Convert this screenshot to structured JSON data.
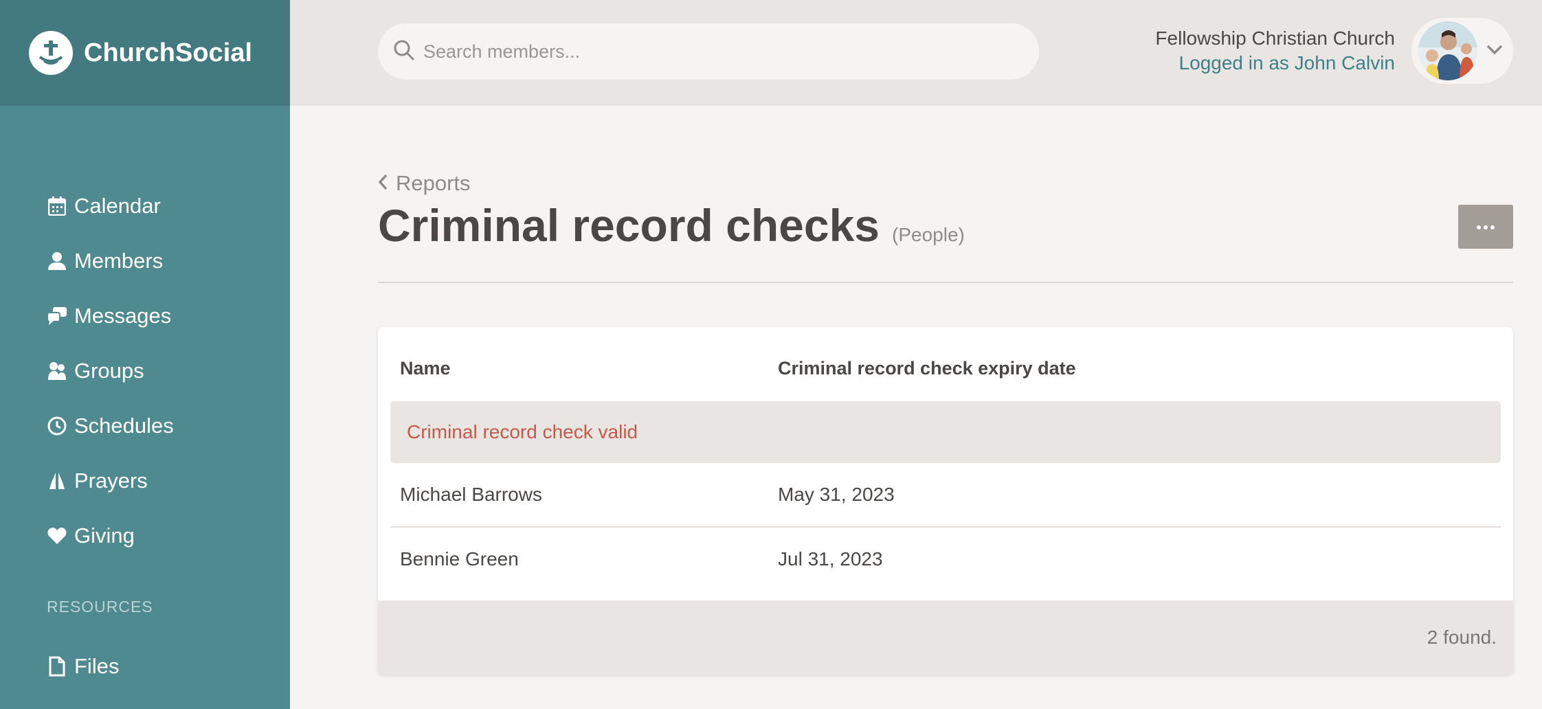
{
  "brand": {
    "name": "ChurchSocial"
  },
  "nav": {
    "items": [
      {
        "label": "Calendar",
        "icon": "calendar-icon"
      },
      {
        "label": "Members",
        "icon": "person-icon"
      },
      {
        "label": "Messages",
        "icon": "chat-bubbles-icon"
      },
      {
        "label": "Groups",
        "icon": "group-icon"
      },
      {
        "label": "Schedules",
        "icon": "clock-icon"
      },
      {
        "label": "Prayers",
        "icon": "praying-hands-icon"
      },
      {
        "label": "Giving",
        "icon": "heart-icon"
      }
    ],
    "section_label": "RESOURCES",
    "files_label": "Files"
  },
  "search": {
    "placeholder": "Search members..."
  },
  "account": {
    "church": "Fellowship Christian Church",
    "login": "Logged in as John Calvin"
  },
  "page": {
    "back_label": "Reports",
    "title": "Criminal record checks",
    "subtitle": "(People)",
    "more_label": "···"
  },
  "table": {
    "columns": [
      "Name",
      "Criminal record check expiry date"
    ],
    "group_label": "Criminal record check valid",
    "rows": [
      {
        "name": "Michael Barrows",
        "expiry": "May 31, 2023"
      },
      {
        "name": "Bennie Green",
        "expiry": "Jul 31, 2023"
      }
    ],
    "footer": "2 found."
  },
  "colors": {
    "sidebar": "#4f8a90",
    "brand_bar": "#437a7f",
    "accent_link": "#3d8187",
    "group_text": "#c65a4a"
  }
}
